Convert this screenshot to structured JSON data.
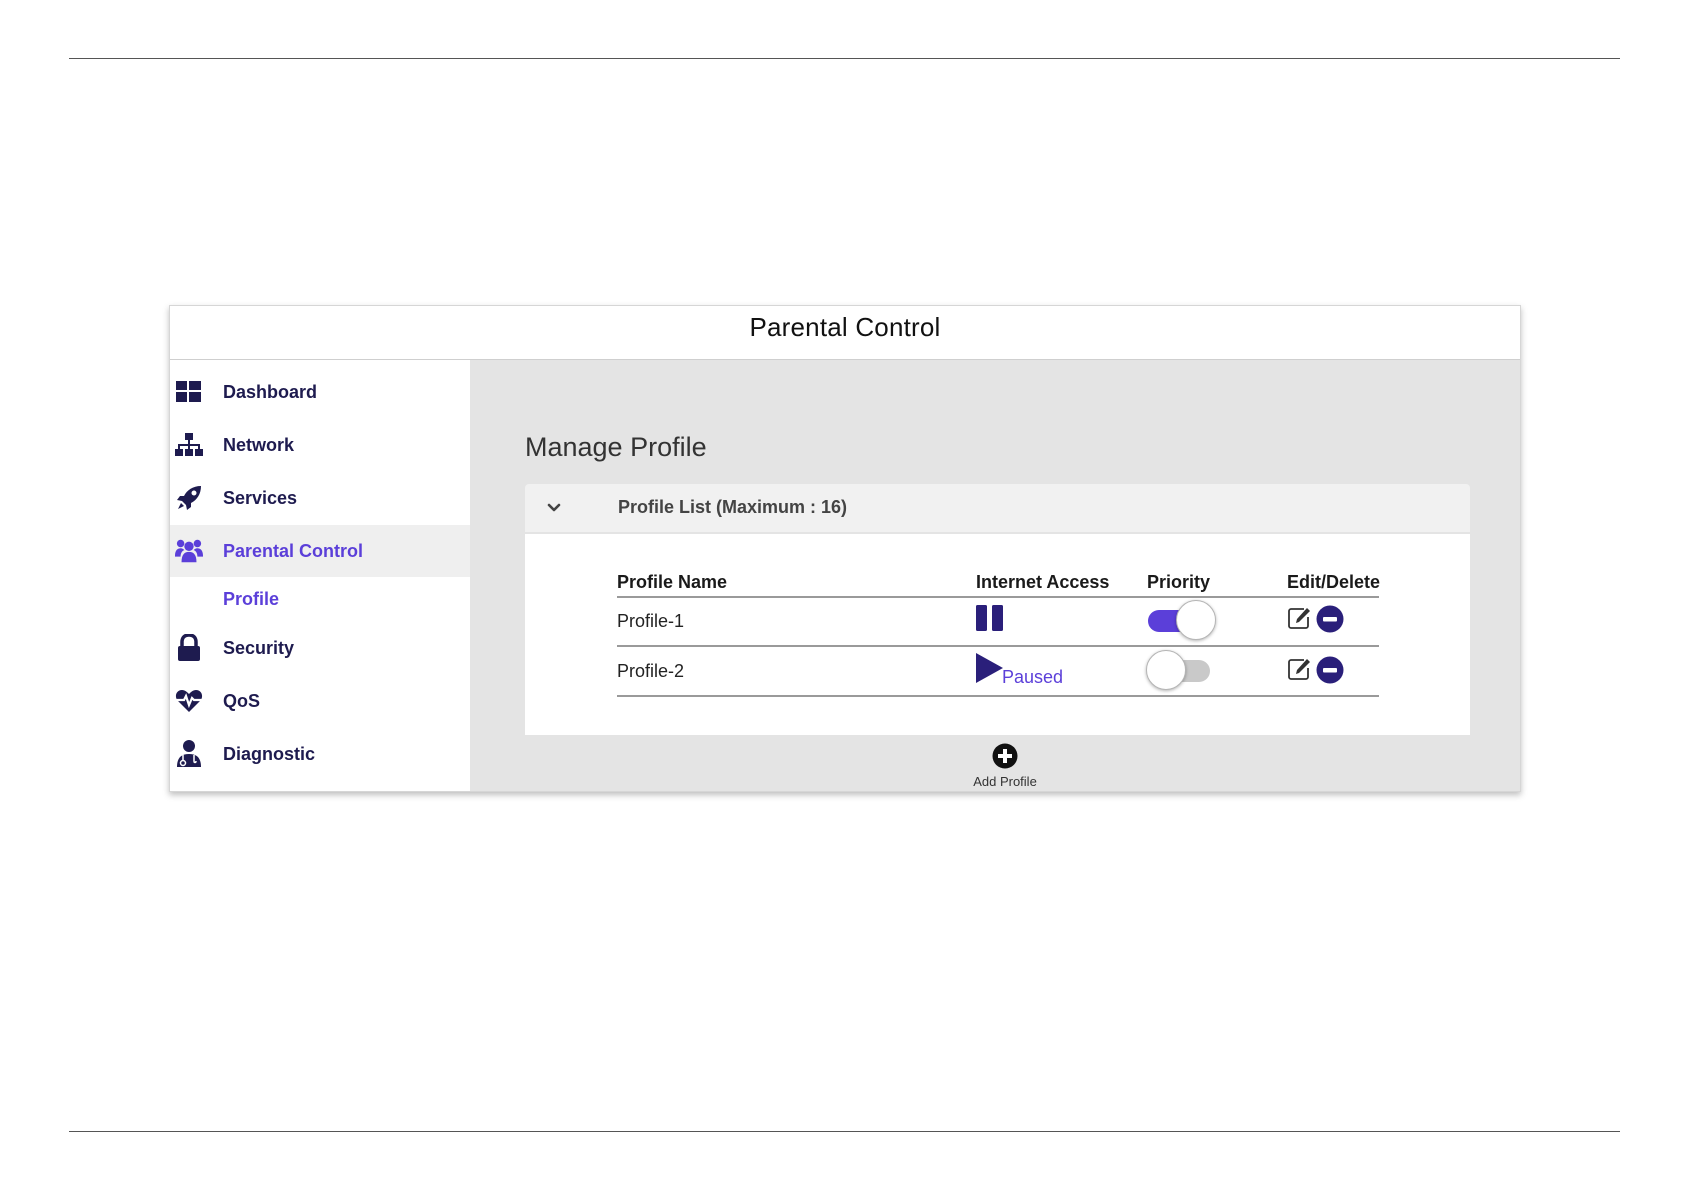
{
  "window": {
    "title": "Parental Control"
  },
  "sidebar": {
    "items": [
      {
        "label": "Dashboard",
        "icon": "dashboard-icon"
      },
      {
        "label": "Network",
        "icon": "network-icon"
      },
      {
        "label": "Services",
        "icon": "rocket-icon"
      },
      {
        "label": "Parental Control",
        "icon": "users-icon",
        "active": true
      },
      {
        "label": "Security",
        "icon": "lock-icon"
      },
      {
        "label": "QoS",
        "icon": "heartbeat-icon"
      },
      {
        "label": "Diagnostic",
        "icon": "user-md-icon"
      }
    ],
    "subitem": {
      "label": "Profile"
    }
  },
  "main": {
    "section_title": "Manage Profile",
    "profile_list": {
      "title": "Profile List (Maximum : 16)",
      "columns": [
        "Profile Name",
        "Internet Access",
        "Priority",
        "Edit/Delete"
      ],
      "rows": [
        {
          "name": "Profile-1",
          "internet_access": "active",
          "access_icon": "pause-icon",
          "status_text": "",
          "priority": true
        },
        {
          "name": "Profile-2",
          "internet_access": "paused",
          "access_icon": "play-icon",
          "status_text": "Paused",
          "priority": false
        }
      ]
    },
    "add_profile": {
      "label": "Add Profile",
      "icon": "plus-circle-icon"
    }
  },
  "colors": {
    "accent": "#5b3fd9",
    "navy": "#1e1b4f",
    "toggle_off": "#c9c9c9",
    "content_bg": "#e4e4e4"
  }
}
